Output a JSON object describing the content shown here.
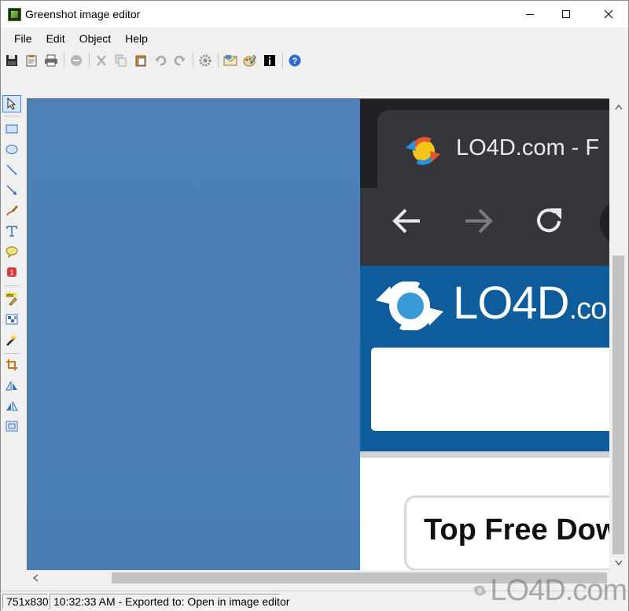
{
  "window": {
    "title": "Greenshot image editor"
  },
  "menu": {
    "items": [
      "File",
      "Edit",
      "Object",
      "Help"
    ]
  },
  "toolbar": {
    "buttons": [
      "save-icon",
      "clipboard-icon",
      "print-icon",
      "delete-icon",
      "cut-icon",
      "copy-icon",
      "paste-icon",
      "undo-icon",
      "redo-icon",
      "settings-icon",
      "email-icon",
      "paint-icon",
      "info-icon",
      "help-icon"
    ]
  },
  "tools": [
    "cursor-icon",
    "rectangle-icon",
    "ellipse-icon",
    "line-icon",
    "arrow-icon",
    "freehand-icon",
    "text-icon",
    "speechbubble-icon",
    "counter-icon",
    "highlight-icon",
    "obfuscate-icon",
    "autocrop-icon",
    "crop-icon",
    "rotate-left-icon",
    "rotate-right-icon",
    "resize-icon"
  ],
  "canvas": {
    "browser_tab_title": "LO4D.com - F",
    "site_name": "LO4D",
    "site_suffix": ".co",
    "card_title": "Top Free Dow"
  },
  "status": {
    "size": "751x830",
    "message": "10:32:33 AM - Exported to: Open in image editor"
  },
  "watermark": {
    "text": "LO4D.com"
  },
  "colors": {
    "desktop": "#4a7cb4",
    "site_header": "#0e5c9b",
    "browser_chrome": "#202124"
  }
}
